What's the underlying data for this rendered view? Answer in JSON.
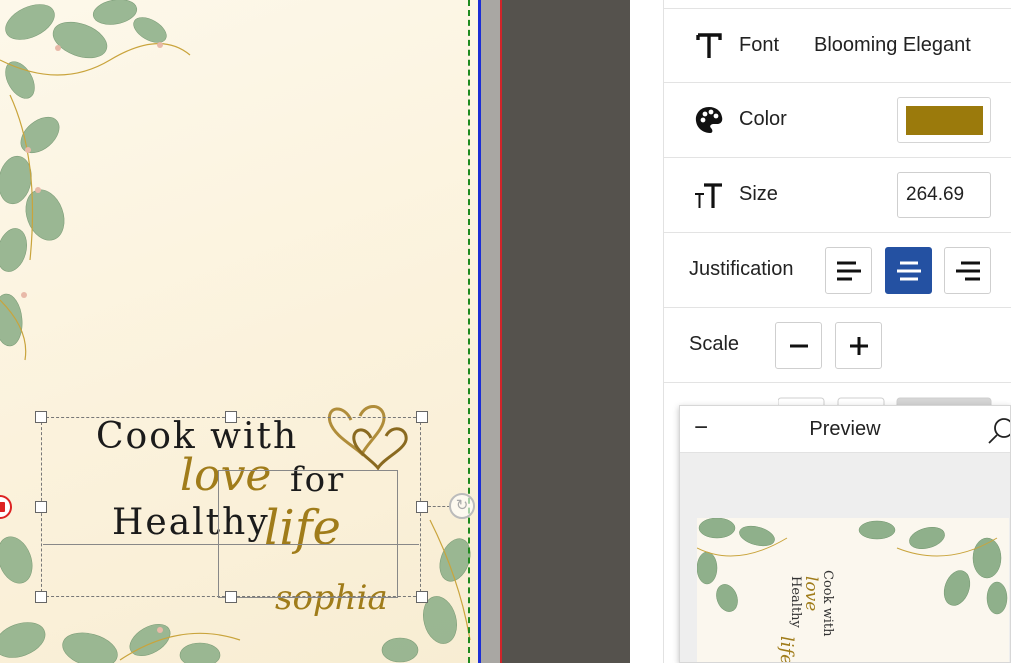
{
  "design": {
    "line1": "Cook with",
    "script_love": "love",
    "word_for": "for",
    "line3": "Healthy",
    "script_life": "life",
    "signature": "sophia"
  },
  "panel": {
    "font_label": "Font",
    "font_value": "Blooming Elegant",
    "color_label": "Color",
    "color_value": "#9b7a0c",
    "size_label": "Size",
    "size_value": "264.69",
    "justification_label": "Justification",
    "justification_selected": "center",
    "scale_label": "Scale"
  },
  "preview": {
    "title": "Preview",
    "minimize_symbol": "−"
  },
  "colors": {
    "safe_guide": "#1f8a1f",
    "trim_guide": "#1c2ed6",
    "bleed_guide": "#d0242a",
    "active_button": "#2451a2",
    "script_gold": "#a07c1a"
  }
}
